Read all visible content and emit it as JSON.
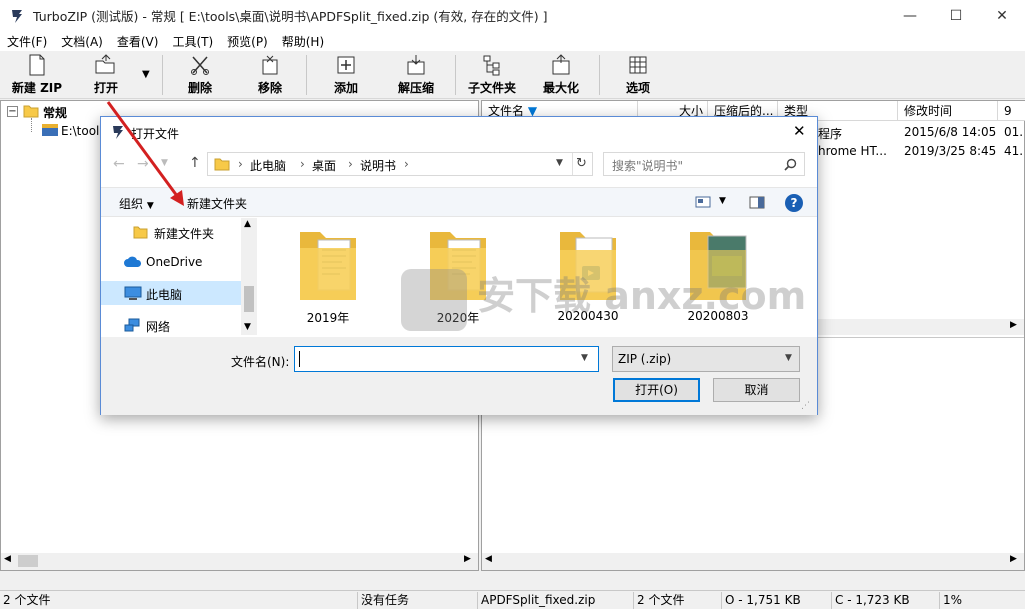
{
  "window": {
    "title": "TurboZIP (测试版) - 常规 [ E:\\tools\\桌面\\说明书\\APDFSplit_fixed.zip (有效, 存在的文件) ]",
    "minimize": "—",
    "maximize": "☐",
    "close": "✕"
  },
  "menu": [
    "文件(F)",
    "文档(A)",
    "查看(V)",
    "工具(T)",
    "预览(P)",
    "帮助(H)"
  ],
  "toolbar": {
    "new_zip": "新建 ZIP",
    "open": "打开",
    "delete": "删除",
    "move": "移除",
    "add": "添加",
    "extract": "解压缩",
    "subfolder": "子文件夹",
    "maximize": "最大化",
    "options": "选项"
  },
  "tree": {
    "root": "常规",
    "child": "E:\\tool"
  },
  "list": {
    "columns": [
      "文件名",
      "大小",
      "压缩后的...",
      "类型",
      "修改时间",
      "9"
    ],
    "rows": [
      {
        "type": "程序",
        "modified": "2015/6/8 14:05",
        "extra": "01."
      },
      {
        "type": "hrome HT...",
        "modified": "2019/3/25 8:45",
        "extra": "41."
      }
    ]
  },
  "status": {
    "files_left": "2 个文件",
    "task": "没有任务",
    "archive": "APDFSplit_fixed.zip",
    "files_right": "2 个文件",
    "original": "O - 1,751 KB",
    "compressed": "C - 1,723 KB",
    "ratio": "1%"
  },
  "dialog": {
    "title": "打开文件",
    "breadcrumb": [
      "此电脑",
      "桌面",
      "说明书"
    ],
    "search_placeholder": "搜索\"说明书\"",
    "organize": "组织",
    "new_folder": "新建文件夹",
    "nav": [
      {
        "label": "新建文件夹",
        "icon": "folder-icon"
      },
      {
        "label": "OneDrive",
        "icon": "cloud-icon"
      },
      {
        "label": "此电脑",
        "icon": "computer-icon"
      },
      {
        "label": "网络",
        "icon": "network-icon"
      }
    ],
    "folders": [
      "2019年",
      "2020年",
      "20200430",
      "20200803"
    ],
    "filename_label": "文件名(N):",
    "filename_value": "",
    "filetype": "ZIP (.zip)",
    "open_btn": "打开(O)",
    "cancel_btn": "取消"
  },
  "watermark": "安下载 anxz.com",
  "colors": {
    "accent": "#0078d7",
    "arrow": "#d32020",
    "folder": "#f7c948"
  }
}
